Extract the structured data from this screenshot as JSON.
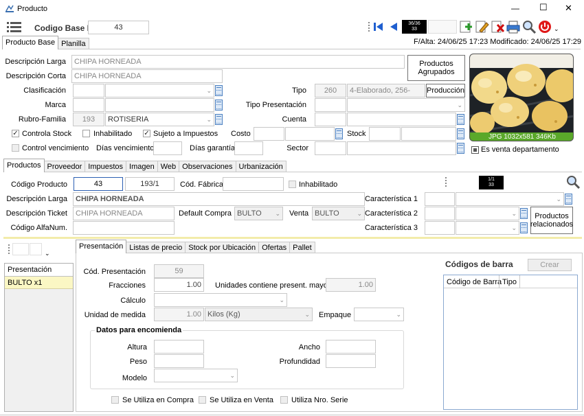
{
  "window": {
    "title": "Producto",
    "minimize": "—",
    "maximize": "☐",
    "close": "✕"
  },
  "header": {
    "codigo_base_label": "Codigo Base Nº",
    "codigo_base_value": "43",
    "nav_counter_top": "36/36",
    "nav_counter_bottom": "33",
    "alta_info": "F/Alta: 24/06/25 17:23 Modificado: 24/06/25 17:29"
  },
  "top_tabs": [
    "Producto Base",
    "Planilla"
  ],
  "base": {
    "desc_larga_label": "Descripción Larga",
    "desc_larga_value": "CHIPA HORNEADA",
    "desc_corta_label": "Descripción Corta",
    "desc_corta_value": "CHIPA HORNEADA",
    "clasificacion_label": "Clasificación",
    "marca_label": "Marca",
    "rubro_label": "Rubro-Familia",
    "rubro_code": "193",
    "rubro_value": "ROTISERIA",
    "tipo_label": "Tipo",
    "tipo_code": "260",
    "tipo_value": "4-Elaborado, 256-",
    "produccion_button": "Producción",
    "tipo_presentacion_label": "Tipo Presentación",
    "cuenta_label": "Cuenta",
    "controla_stock_label": "Controla Stock",
    "controla_stock_checked": true,
    "inhabilitado_label": "Inhabilitado",
    "inhabilitado_checked": false,
    "sujeto_impuestos_label": "Sujeto a Impuestos",
    "sujeto_impuestos_checked": true,
    "costo_label": "Costo",
    "stock_label": "Stock",
    "control_venc_label": "Control vencimiento",
    "dias_venc_label": "Días vencimiento",
    "dias_garantia_label": "Días garantía",
    "sector_label": "Sector",
    "productos_agrupados_button": "Productos\nAgrupados",
    "image_caption": "JPG 1032x581 346Kb",
    "es_venta_depto_label": "Es venta departamento"
  },
  "sub_tabs": [
    "Productos",
    "Proveedor",
    "Impuestos",
    "Imagen",
    "Web",
    "Observaciones",
    "Urbanización"
  ],
  "productos": {
    "codigo_producto_label": "Código Producto",
    "codigo_producto_value": "43",
    "codigo_producto_sub": "193/1",
    "cod_fabrica_label": "Cód. Fábrica",
    "inhabilitado_label": "Inhabilitado",
    "counter_top": "1/1",
    "counter_bottom": "33",
    "desc_larga_label": "Descripción Larga",
    "desc_larga_value": "CHIPA HORNEADA",
    "desc_ticket_label": "Descripción Ticket",
    "desc_ticket_value": "CHIPA HORNEADA",
    "default_compra_label": "Default Compra",
    "default_compra_value": "BULTO",
    "venta_label": "Venta",
    "venta_value": "BULTO",
    "codigo_alfanum_label": "Código AlfaNum.",
    "caracteristica1_label": "Característica 1",
    "caracteristica2_label": "Característica 2",
    "caracteristica3_label": "Característica 3",
    "productos_relacionados_button": "Productos\nrelacionados"
  },
  "presentacion_list": {
    "header": "Presentación",
    "items": [
      "BULTO x1"
    ]
  },
  "pres_tabs": [
    "Presentación",
    "Listas de precio",
    "Stock por Ubicación",
    "Ofertas",
    "Pallet"
  ],
  "presentacion": {
    "cod_presentacion_label": "Cód. Presentación",
    "cod_presentacion_value": "59",
    "fracciones_label": "Fracciones",
    "fracciones_value": "1.00",
    "unidades_label": "Unidades contiene present. mayor",
    "unidades_value": "1.00",
    "calculo_label": "Cálculo",
    "unidad_medida_label": "Unidad de medida",
    "unidad_medida_value": "1.00",
    "unidad_medida_unit": "Kilos (Kg)",
    "empaque_label": "Empaque",
    "encomienda_title": "Datos para encomienda",
    "altura_label": "Altura",
    "ancho_label": "Ancho",
    "peso_label": "Peso",
    "profundidad_label": "Profundidad",
    "modelo_label": "Modelo",
    "se_utiliza_compra_label": "Se Utiliza en Compra",
    "se_utiliza_venta_label": "Se Utiliza en Venta",
    "utiliza_serie_label": "Utiliza Nro. Serie"
  },
  "barcodes": {
    "title": "Códigos de barra",
    "crear_button": "Crear",
    "columns": [
      "Código de Barra",
      "Tipo"
    ]
  }
}
